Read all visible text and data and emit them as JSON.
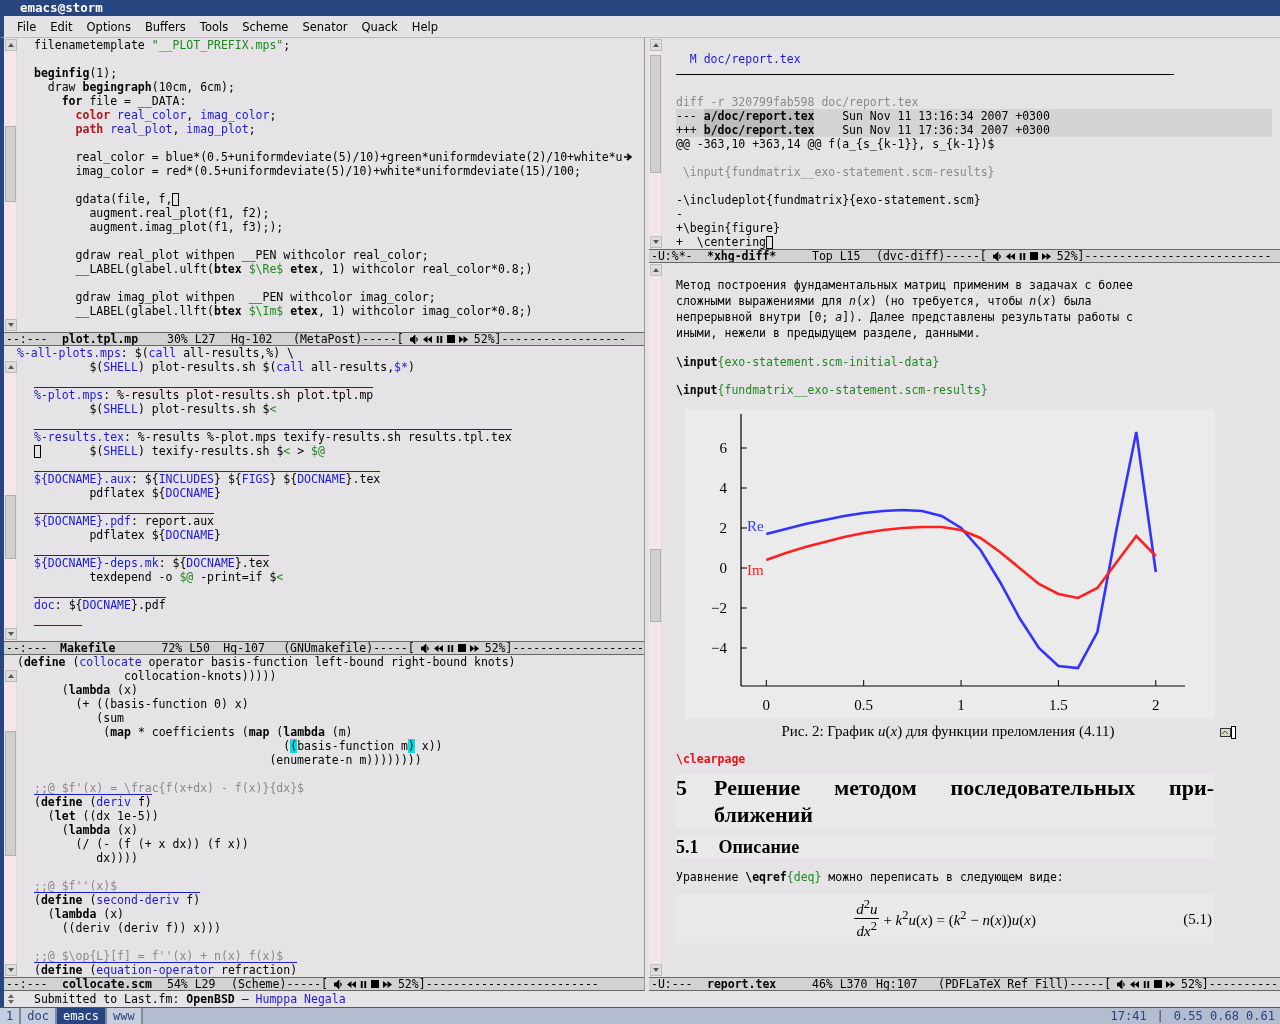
{
  "window": {
    "title": "emacs@storm"
  },
  "menu": [
    "File",
    "Edit",
    "Options",
    "Buffers",
    "Tools",
    "Scheme",
    "Senator",
    "Quack",
    "Help"
  ],
  "left_column": [
    {
      "lines": [
        {
          "kind": "code",
          "segments": [
            "filenametemplate ",
            {
              "kind": "str",
              "text": "\"__PLOT_PREFIX.mps\""
            },
            ";"
          ]
        },
        {
          "kind": "code"
        },
        {
          "kind": "code",
          "segments": [
            {
              "kind": "kw",
              "text": "beginfig"
            },
            "(1);"
          ]
        },
        {
          "kind": "code",
          "segments": [
            "  draw ",
            {
              "kind": "kw",
              "text": "begingraph"
            },
            "(10cm, 6cm);"
          ]
        },
        {
          "kind": "code",
          "segments": [
            {
              "kind": "kw",
              "text": "    for"
            },
            " file = __DATA:"
          ]
        },
        {
          "kind": "code",
          "segments": [
            {
              "kind": "type",
              "text": "      color"
            },
            {
              "kind": "fn",
              "text": " real_color"
            },
            ", ",
            {
              "kind": "fn",
              "text": "imag_color"
            },
            ";"
          ]
        },
        {
          "kind": "code",
          "segments": [
            {
              "kind": "type",
              "text": "      path"
            },
            {
              "kind": "fn",
              "text": " real_plot"
            },
            ", ",
            {
              "kind": "fn",
              "text": "imag_plot"
            },
            ";"
          ]
        },
        {
          "kind": "code"
        },
        {
          "kind": "wrapped",
          "segments": [
            "      real_color = blue*(0.5+uniformdeviate(5)/10)+green*uniformdeviate(2)/10+white*u"
          ]
        },
        {
          "kind": "code",
          "segments": [
            "      imag_color = red*(0.5+uniformdeviate(5)/10)+white*uniformdeviate(15)/100;"
          ]
        },
        {
          "kind": "code"
        },
        {
          "kind": "cursor_end",
          "segments": [
            "      gdata(file, f,"
          ]
        },
        {
          "kind": "code",
          "segments": [
            "        augment.real_plot(f1, f2);"
          ]
        },
        {
          "kind": "code",
          "segments": [
            "        augment.imag_plot(f1, f3););"
          ]
        },
        {
          "kind": "code"
        },
        {
          "kind": "code",
          "segments": [
            "      gdraw real_plot withpen __PEN withcolor real_color;"
          ]
        },
        {
          "kind": "code",
          "segments": [
            "      __LABEL(glabel.ulft(",
            {
              "kind": "kw",
              "text": "btex"
            },
            {
              "kind": "str",
              "text": " $\\Re$"
            },
            {
              "kind": "kw",
              "text": " etex"
            },
            ", 1) withcolor real_color*0.8;)"
          ]
        },
        {
          "kind": "code"
        },
        {
          "kind": "code",
          "segments": [
            "      gdraw imag_plot withpen  __PEN withcolor imag_color;"
          ]
        },
        {
          "kind": "code",
          "segments": [
            "      __LABEL(glabel.llft(",
            {
              "kind": "kw",
              "text": "btex"
            },
            {
              "kind": "str",
              "text": " $\\Im$"
            },
            {
              "kind": "kw",
              "text": " etex"
            },
            ", 1) withcolor imag_color*0.8;)"
          ]
        }
      ],
      "mode_line": {
        "flags": "--:---",
        "buffer": "plot.tpl.mp",
        "position": "30% L27",
        "vc": "Hg-102",
        "mode": "(MetaPost)-----[",
        "volume": "52%]",
        "tail": "------------------"
      }
    },
    {
      "header": [
        {
          "kind": "fn",
          "text": "%-all-plots.mps"
        },
        ": $(",
        {
          "kind": "fn",
          "text": "call"
        },
        " all-results,%) \\"
      ],
      "lines": [
        {
          "kind": "code",
          "segments": [
            "        $(",
            {
              "kind": "fn",
              "text": "SHELL"
            },
            ") plot-results.sh $(",
            {
              "kind": "fn",
              "text": "call"
            },
            " all-results,",
            {
              "kind": "fn",
              "text": "$*"
            },
            ")"
          ]
        },
        {
          "kind": "ruled"
        },
        {
          "kind": "code",
          "segments": [
            {
              "kind": "fn",
              "text": "%-plot.mps"
            },
            ": %-results plot-results.sh plot.tpl.mp"
          ]
        },
        {
          "kind": "code",
          "segments": [
            "        $(",
            {
              "kind": "fn",
              "text": "SHELL"
            },
            ") plot-results.sh $",
            {
              "kind": "str",
              "text": "<"
            }
          ]
        },
        {
          "kind": "ruled"
        },
        {
          "kind": "code",
          "segments": [
            {
              "kind": "fn",
              "text": "%-results.tex"
            },
            ": %-results %-plot.mps texify-results.sh results.tpl.tex"
          ]
        },
        {
          "kind": "cursor_start",
          "segments": [
            "       $(",
            {
              "kind": "fn",
              "text": "SHELL"
            },
            ") texify-results.sh $",
            {
              "kind": "str",
              "text": "<"
            },
            " > ",
            {
              "kind": "str",
              "text": "$@"
            }
          ]
        },
        {
          "kind": "ruled"
        },
        {
          "kind": "code",
          "segments": [
            {
              "kind": "fn",
              "text": "${DOCNAME}.aux"
            },
            ": ${",
            {
              "kind": "fn",
              "text": "INCLUDES"
            },
            "} ${",
            {
              "kind": "fn",
              "text": "FIGS"
            },
            "} ${",
            {
              "kind": "fn",
              "text": "DOCNAME"
            },
            "}.tex"
          ]
        },
        {
          "kind": "code",
          "segments": [
            "        pdflatex ${",
            {
              "kind": "fn",
              "text": "DOCNAME"
            },
            "}"
          ]
        },
        {
          "kind": "ruled"
        },
        {
          "kind": "code",
          "segments": [
            {
              "kind": "fn",
              "text": "${DOCNAME}.pdf"
            },
            ": report.aux"
          ]
        },
        {
          "kind": "code",
          "segments": [
            "        pdflatex ${",
            {
              "kind": "fn",
              "text": "DOCNAME"
            },
            "}"
          ]
        },
        {
          "kind": "ruled"
        },
        {
          "kind": "code",
          "segments": [
            {
              "kind": "fn",
              "text": "${DOCNAME}-deps.mk"
            },
            ": ${",
            {
              "kind": "fn",
              "text": "DOCNAME"
            },
            "}.tex"
          ]
        },
        {
          "kind": "code",
          "segments": [
            "        texdepend -o ",
            {
              "kind": "str",
              "text": "$@"
            },
            " -print=if $",
            {
              "kind": "str",
              "text": "<"
            }
          ]
        },
        {
          "kind": "ruled"
        },
        {
          "kind": "code",
          "segments": [
            {
              "kind": "fn",
              "text": "doc"
            },
            ": ${",
            {
              "kind": "fn",
              "text": "DOCNAME"
            },
            "}.pdf"
          ]
        },
        {
          "kind": "ruled"
        }
      ],
      "mode_line": {
        "flags": "--:---",
        "buffer": "Makefile",
        "position": "72% L50",
        "vc": "Hg-107",
        "mode": "(GNUmakefile)-----[",
        "volume": "52%]",
        "tail": "-------------------"
      }
    },
    {
      "header": [
        "(",
        {
          "kind": "kw",
          "text": "define"
        },
        " (",
        {
          "kind": "fn",
          "text": "collocate"
        },
        " operator basis-function left-bound right-bound knots)"
      ],
      "lines": [
        {
          "kind": "code",
          "segments": [
            "             collocation-knots)))))"
          ]
        },
        {
          "kind": "code",
          "segments": [
            "    (",
            {
              "kind": "kw",
              "text": "lambda"
            },
            " (x)"
          ]
        },
        {
          "kind": "code",
          "segments": [
            "      (+ ((basis-function 0) x)"
          ]
        },
        {
          "kind": "code",
          "segments": [
            "         (sum"
          ]
        },
        {
          "kind": "code",
          "segments": [
            "          (",
            {
              "kind": "kw",
              "text": "map"
            },
            " * coefficients (",
            {
              "kind": "kw",
              "text": "map"
            },
            " (",
            {
              "kind": "kw",
              "text": "lambda"
            },
            " (m)"
          ]
        },
        {
          "kind": "code",
          "segments": [
            "                                    (",
            {
              "kind": "hl",
              "text": "("
            },
            "basis-function m",
            {
              "kind": "hl",
              "text": ")"
            },
            " x))"
          ]
        },
        {
          "kind": "code",
          "segments": [
            "                                  (enumerate-n m))))))))"
          ]
        },
        {
          "kind": "code"
        },
        {
          "kind": "ruled",
          "segments": [
            {
              "kind": "cmt",
              "text": ";;@ $f'(x) = \\frac{f(x+dx) - f(x)}{dx}$"
            }
          ]
        },
        {
          "kind": "code",
          "segments": [
            "(",
            {
              "kind": "kw",
              "text": "define"
            },
            " (",
            {
              "kind": "fn",
              "text": "deriv"
            },
            " f)"
          ]
        },
        {
          "kind": "code",
          "segments": [
            "  (",
            {
              "kind": "kw",
              "text": "let"
            },
            " ((dx 1e-5))"
          ]
        },
        {
          "kind": "code",
          "segments": [
            "    (",
            {
              "kind": "kw",
              "text": "lambda"
            },
            " (x)"
          ]
        },
        {
          "kind": "code",
          "segments": [
            "      (/ (- (f (+ x dx)) (f x))"
          ]
        },
        {
          "kind": "code",
          "segments": [
            "         dx))))"
          ]
        },
        {
          "kind": "code"
        },
        {
          "kind": "ruled",
          "segments": [
            {
              "kind": "cmt",
              "text": ";;@ $f''(x)$"
            }
          ]
        },
        {
          "kind": "code",
          "segments": [
            "(",
            {
              "kind": "kw",
              "text": "define"
            },
            " (",
            {
              "kind": "fn",
              "text": "second-deriv"
            },
            " f)"
          ]
        },
        {
          "kind": "code",
          "segments": [
            "  (",
            {
              "kind": "kw",
              "text": "lambda"
            },
            " (x)"
          ]
        },
        {
          "kind": "code",
          "segments": [
            "    ((deriv (deriv f)) x)))"
          ]
        },
        {
          "kind": "code"
        },
        {
          "kind": "ruled",
          "segments": [
            {
              "kind": "cmt",
              "text": ";;@ $\\op{L}[f] = f''(x) + n(x) f(x)$"
            }
          ]
        },
        {
          "kind": "code",
          "segments": [
            "(",
            {
              "kind": "kw",
              "text": "define"
            },
            " (",
            {
              "kind": "fn",
              "text": "equation-operator"
            },
            " refraction)"
          ]
        }
      ],
      "mode_line": {
        "flags": "--:---",
        "buffer": "collocate.scm",
        "position": "54% L29",
        "mode": "(Scheme)-----[",
        "volume": "52%]",
        "tail": "-------------------------"
      }
    }
  ],
  "right_column": {
    "diff_pane": {
      "lines": [
        {
          "kind": "code"
        },
        {
          "kind": "code",
          "segments": [
            {
              "kind": "fn",
              "text": "  M doc/report.tex"
            }
          ]
        },
        {
          "kind": "separator"
        },
        {
          "kind": "code"
        },
        {
          "kind": "code",
          "segments": [
            {
              "kind": "dim",
              "text": "diff -r 320799fab598 doc/report.tex"
            }
          ]
        },
        {
          "kind": "header",
          "segments": [
            "--- ",
            {
              "kind": "hdr",
              "text": "a/doc/report.tex"
            },
            "    Sun Nov 11 13:16:34 2007 +0300"
          ]
        },
        {
          "kind": "header",
          "segments": [
            "+++ ",
            {
              "kind": "hdr",
              "text": "b/doc/report.tex"
            },
            "    Sun Nov 11 17:36:34 2007 +0300"
          ]
        },
        {
          "kind": "code",
          "segments": [
            "@@ -363,10 +363,14 @@ f(a_{s_{k-1}}, s_{k-1})$"
          ]
        },
        {
          "kind": "code"
        },
        {
          "kind": "code",
          "segments": [
            {
              "kind": "dim",
              "text": " \\input{fundmatrix__exo-statement.scm-results}"
            }
          ]
        },
        {
          "kind": "code"
        },
        {
          "kind": "code",
          "segments": [
            "-\\includeplot{fundmatrix}{exo-statement.scm}"
          ]
        },
        {
          "kind": "code",
          "segments": [
            "-"
          ]
        },
        {
          "kind": "code",
          "segments": [
            "+\\begin{figure}"
          ]
        },
        {
          "kind": "cursor_end",
          "segments": [
            "+  \\centering"
          ]
        }
      ],
      "mode_line": {
        "flags": "-U:%*-",
        "buffer": "*xhg-diff*",
        "position": "Top L15",
        "mode": "(dvc-diff)-----[",
        "volume": "52%]",
        "tail": "---------------------------"
      }
    },
    "report_pane": {
      "paragraph": "Метод построения фундаментальных матриц применим в задачах с более сложными выражениями для *n*(*x*) (но требуется, чтобы *n*(*x*) была непрерывной внутри [0; *a*]). Далее представлены результаты работы с иными, нежели в предыдущем разделе, данными.",
      "inputs": [
        [
          {
            "kind": "kw",
            "text": "\\input"
          },
          {
            "kind": "str",
            "text": "{exo-statement.scm-initial-data}"
          }
        ],
        [
          {
            "kind": "kw",
            "text": "\\input"
          },
          {
            "kind": "str",
            "text": "{fundmatrix__exo-statement.scm-results}"
          }
        ]
      ],
      "chart_data": {
        "type": "line",
        "x": [
          0,
          0.1,
          0.2,
          0.3,
          0.4,
          0.5,
          0.6,
          0.7,
          0.8,
          0.9,
          1,
          1.1,
          1.2,
          1.3,
          1.4,
          1.5,
          1.6,
          1.7,
          1.8,
          1.9,
          2
        ],
        "series": [
          {
            "name": "Re",
            "color": "#3333ff",
            "values": [
              1.7,
              1.95,
              2.2,
              2.4,
              2.6,
              2.75,
              2.85,
              2.9,
              2.85,
              2.6,
              2.0,
              0.9,
              -0.7,
              -2.5,
              -4.0,
              -4.9,
              -5.0,
              -3.2,
              2.0,
              6.8,
              -0.2
            ]
          },
          {
            "name": "Im",
            "color": "#ff2020",
            "values": [
              0.4,
              0.75,
              1.05,
              1.3,
              1.55,
              1.75,
              1.9,
              2.0,
              2.05,
              2.05,
              1.9,
              1.5,
              0.8,
              0.0,
              -0.8,
              -1.3,
              -1.5,
              -1.0,
              0.3,
              1.6,
              0.6
            ]
          }
        ],
        "xlim": [
          -0.13,
          2.15
        ],
        "ylim": [
          -5.9,
          7.7
        ],
        "xticks": [
          0,
          0.5,
          1,
          1.5,
          2
        ],
        "yticks": [
          {
            "value": -4,
            "label": "−4"
          },
          {
            "value": -2,
            "label": "−2"
          },
          0,
          2,
          4,
          6
        ]
      },
      "caption": "Рис. 2: График *u*(*x*) для функции преломления (4.11)",
      "clearpage": "\\clearpage",
      "section": {
        "number": "5",
        "title_lines": [
          "Решение методом последовательных при-",
          "ближений"
        ]
      },
      "subsection": {
        "number": "5.1",
        "title": "Описание"
      },
      "equation_intro": [
        "Уравнение ",
        {
          "kind": "kw",
          "text": "\\eqref"
        },
        {
          "kind": "str",
          "text": "{deq}"
        },
        " можно переписать в следующем виде:"
      ],
      "equation": {
        "numerator": "*d*$^{2}$*u*",
        "denominator": "*dx*$^{2}$",
        "rest": "+ *k*$^{2}$*u*(*x*) = (*k*$^{2}$ − *n*(*x*))*u*(*x*)",
        "number": "(5.1)"
      },
      "mode_line": {
        "flags": "-U:---",
        "buffer": "report.tex",
        "position": "46% L370",
        "vc": "Hg:107",
        "mode": "(PDFLaTeX Ref Fill)-----[",
        "volume": "52%]",
        "tail": "----------"
      }
    }
  },
  "minibuffer": {
    "message": "Submitted to Last.fm: **OpenBSD** —",
    "track": "Humppa Negala"
  },
  "taskbar": {
    "desktops": [
      {
        "label": "1",
        "selected": false
      },
      {
        "label": "doc",
        "selected": false
      },
      {
        "label": "emacs",
        "selected": true
      },
      {
        "label": "www",
        "selected": false
      }
    ],
    "clock": "17:41",
    "separator": "|",
    "load": "0.55 0.68 0.61"
  }
}
